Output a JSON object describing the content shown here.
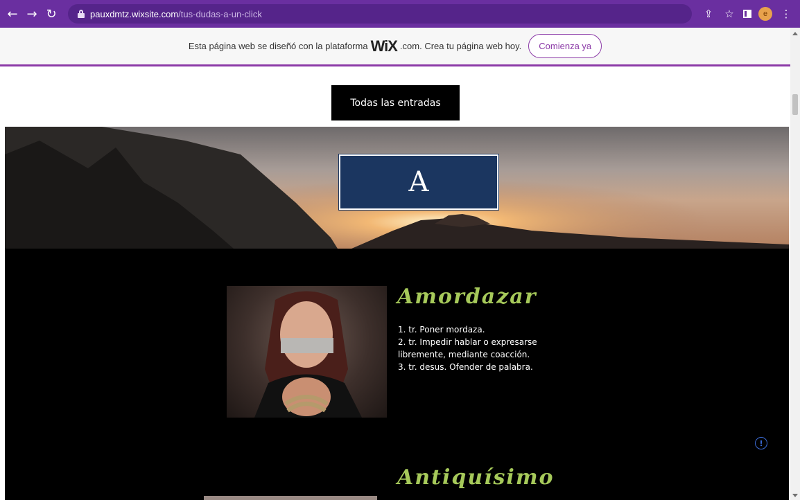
{
  "browser": {
    "url_host": "pauxdmtz.wixsite.com",
    "url_path": "/tus-dudas-a-un-click",
    "profile_initial": "e",
    "icons": [
      "back-arrow-icon",
      "forward-arrow-icon",
      "reload-icon",
      "lock-icon",
      "share-icon",
      "star-icon",
      "side-panel-icon",
      "menu-dots-icon"
    ]
  },
  "wix_banner": {
    "text_before": "Esta página web se diseñó con la plataforma",
    "logo": "WiX",
    "text_after": ".com. Crea tu página web hoy.",
    "cta_label": "Comienza ya"
  },
  "page": {
    "all_posts_label": "Todas las entradas",
    "hero_letter": "A",
    "entries": [
      {
        "title": "Amordazar",
        "definitions": [
          "1. tr. Poner mordaza.",
          "2. tr. Impedir hablar o expresarse",
          "libremente, mediante coacción.",
          "3. tr. desus. Ofender de palabra."
        ]
      },
      {
        "title": "Antiquísimo"
      }
    ],
    "info_icon_glyph": "!"
  },
  "colors": {
    "chrome": "#6a2fa0",
    "accent_purple": "#8b3aa7",
    "letter_box": "#1b3660",
    "entry_title": "#a6c95a"
  }
}
